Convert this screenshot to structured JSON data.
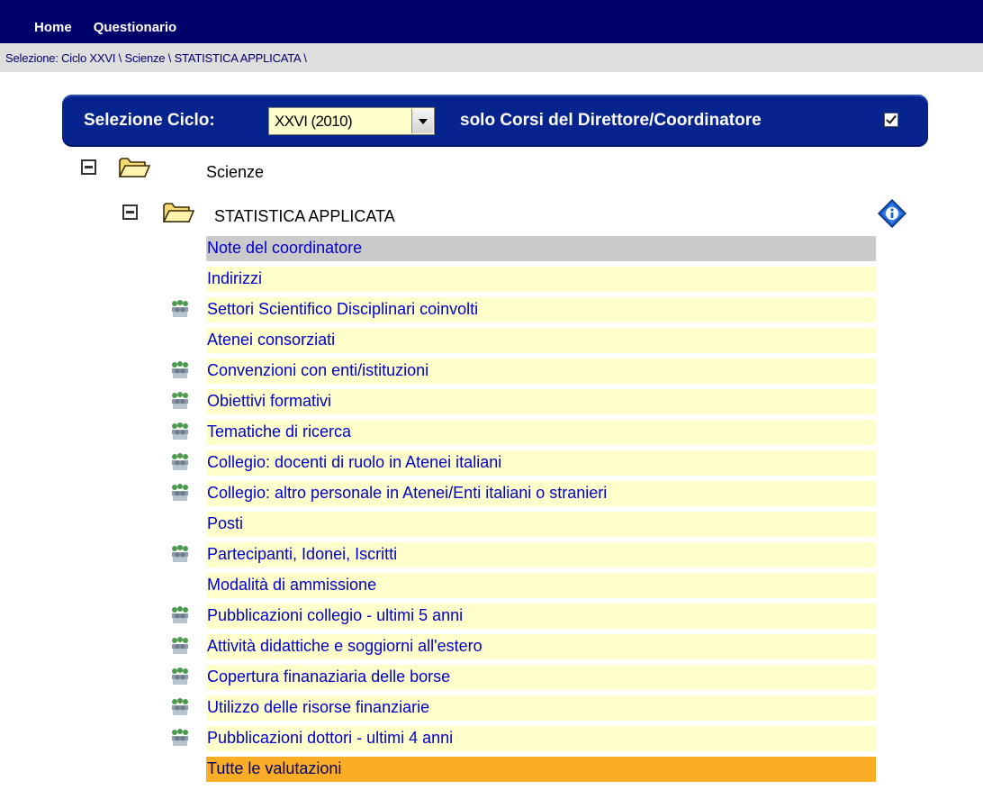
{
  "nav": {
    "home": "Home",
    "questionario": "Questionario"
  },
  "breadcrumb": "Selezione: Ciclo XXVI \\ Scienze \\ STATISTICA APPLICATA \\",
  "selector": {
    "label": "Selezione Ciclo:",
    "value": "XXVI (2010)",
    "checkbox_label": "solo Corsi del Direttore/Coordinatore",
    "checked": true
  },
  "tree": {
    "root": {
      "label": "Scienze",
      "expanded": true
    },
    "course": {
      "label": "STATISTICA APPLICATA",
      "expanded": true
    }
  },
  "items": [
    {
      "label": "Note del coordinatore",
      "icon": false,
      "state": "selected"
    },
    {
      "label": "Indirizzi",
      "icon": false
    },
    {
      "label": "Settori Scientifico Disciplinari coinvolti",
      "icon": true
    },
    {
      "label": "Atenei consorziati",
      "icon": false
    },
    {
      "label": "Convenzioni con enti/istituzioni",
      "icon": true
    },
    {
      "label": "Obiettivi formativi",
      "icon": true
    },
    {
      "label": "Tematiche di ricerca",
      "icon": true
    },
    {
      "label": "Collegio: docenti di ruolo in Atenei italiani",
      "icon": true
    },
    {
      "label": "Collegio: altro personale in Atenei/Enti italiani o stranieri",
      "icon": true
    },
    {
      "label": "Posti",
      "icon": false
    },
    {
      "label": "Partecipanti, Idonei, Iscritti",
      "icon": true
    },
    {
      "label": "Modalità di ammissione",
      "icon": false
    },
    {
      "label": "Pubblicazioni collegio - ultimi 5 anni",
      "icon": true
    },
    {
      "label": "Attività didattiche e soggiorni all'estero",
      "icon": true
    },
    {
      "label": "Copertura finanaziaria delle borse",
      "icon": true
    },
    {
      "label": "Utilizzo delle risorse finanziarie",
      "icon": true
    },
    {
      "label": "Pubblicazioni dottori - ultimi 4 anni",
      "icon": true
    },
    {
      "label": "Tutte le valutazioni",
      "icon": false,
      "state": "highlight"
    }
  ],
  "colors": {
    "header": "#00006b",
    "selector_bg": "#07238e",
    "row_bg": "#ffffcc",
    "row_selected": "#cacaca",
    "row_highlight": "#fbad25",
    "link": "#0000cc"
  },
  "icons": {
    "toggle": "minus-box-icon",
    "folder": "open-folder-icon",
    "info": "info-diamond-icon",
    "people": "people-group-icon"
  }
}
